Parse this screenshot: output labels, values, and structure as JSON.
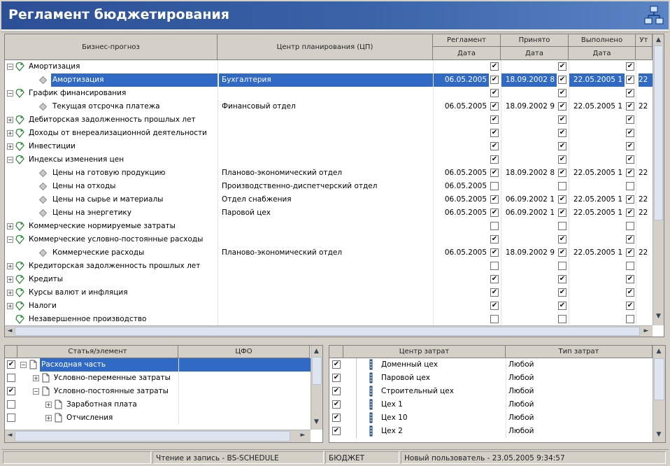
{
  "window": {
    "title": "Регламент бюджетирования"
  },
  "top_grid": {
    "headers": {
      "col1": "Бизнес-прогноз",
      "col2": "Центр планирования (ЦП)",
      "reglament": "Регламент",
      "prinyato": "Принято",
      "vypolneno": "Выполнено",
      "extra": "Ут",
      "date": "Дата"
    },
    "rows": [
      {
        "name": "Амортизация",
        "level": 0,
        "kind": "folder",
        "expand": "−",
        "center": "",
        "d1": "",
        "c1": "✔",
        "d2": "",
        "c2": "✔",
        "d3": "",
        "c3": "✔",
        "d4": ""
      },
      {
        "name": "Амортизация",
        "level": 1,
        "kind": "item",
        "expand": "",
        "center": "Бухгалтерия",
        "d1": "06.05.2005",
        "c1": "✔",
        "d2": "18.09.2002 8",
        "c2": "✔",
        "d3": "22.05.2005 1",
        "c3": "✔",
        "d4": "22",
        "selected": true
      },
      {
        "name": "График финансирования",
        "level": 0,
        "kind": "folder",
        "expand": "−",
        "center": "",
        "d1": "",
        "c1": "✔",
        "d2": "",
        "c2": "✔",
        "d3": "",
        "c3": "✔",
        "d4": ""
      },
      {
        "name": "Текущая отсрочка платежа",
        "level": 1,
        "kind": "item",
        "expand": "",
        "center": "Финансовый отдел",
        "d1": "06.05.2005",
        "c1": "✔",
        "d2": "18.09.2002 9",
        "c2": "✔",
        "d3": "22.05.2005 1",
        "c3": "✔",
        "d4": "22"
      },
      {
        "name": "Дебиторская задолженность прошлых лет",
        "level": 0,
        "kind": "folder",
        "expand": "+",
        "center": "",
        "d1": "",
        "c1": "✔",
        "d2": "",
        "c2": "✔",
        "d3": "",
        "c3": "✔",
        "d4": ""
      },
      {
        "name": "Доходы от внереализационной деятельности",
        "level": 0,
        "kind": "folder",
        "expand": "+",
        "center": "",
        "d1": "",
        "c1": "✔",
        "d2": "",
        "c2": "✔",
        "d3": "",
        "c3": "✔",
        "d4": ""
      },
      {
        "name": "Инвестиции",
        "level": 0,
        "kind": "folder",
        "expand": "+",
        "center": "",
        "d1": "",
        "c1": "✔",
        "d2": "",
        "c2": "✔",
        "d3": "",
        "c3": "✔",
        "d4": ""
      },
      {
        "name": "Индексы изменения цен",
        "level": 0,
        "kind": "folder",
        "expand": "−",
        "center": "",
        "d1": "",
        "c1": "✔",
        "d2": "",
        "c2": "✔",
        "d3": "",
        "c3": "✔",
        "d4": ""
      },
      {
        "name": "Цены на готовую продукцию",
        "level": 1,
        "kind": "item",
        "expand": "",
        "center": "Планово-экономический отдел",
        "d1": "06.05.2005",
        "c1": "✔",
        "d2": "18.09.2002 8",
        "c2": "✔",
        "d3": "22.05.2005 1",
        "c3": "✔",
        "d4": "22"
      },
      {
        "name": "Цены на отходы",
        "level": 1,
        "kind": "item",
        "expand": "",
        "center": "Производственно-диспетчерский отдел",
        "d1": "06.05.2005",
        "c1": "",
        "d2": "",
        "c2": "",
        "d3": "",
        "c3": "",
        "d4": ""
      },
      {
        "name": "Цены на сырье и материалы",
        "level": 1,
        "kind": "item",
        "expand": "",
        "center": "Отдел снабжения",
        "d1": "06.05.2005",
        "c1": "✔",
        "d2": "06.09.2002 1",
        "c2": "✔",
        "d3": "22.05.2005 1",
        "c3": "✔",
        "d4": "22"
      },
      {
        "name": "Цены на энергетику",
        "level": 1,
        "kind": "item",
        "expand": "",
        "center": "Паровой цех",
        "d1": "06.05.2005",
        "c1": "✔",
        "d2": "06.09.2002 1",
        "c2": "✔",
        "d3": "22.05.2005 1",
        "c3": "✔",
        "d4": "22"
      },
      {
        "name": "Коммерческие нормируемые затраты",
        "level": 0,
        "kind": "folder",
        "expand": "+",
        "center": "",
        "d1": "",
        "c1": "",
        "d2": "",
        "c2": "",
        "d3": "",
        "c3": "",
        "d4": ""
      },
      {
        "name": "Коммерческие условно-постоянные расходы",
        "level": 0,
        "kind": "folder",
        "expand": "−",
        "center": "",
        "d1": "",
        "c1": "✔",
        "d2": "",
        "c2": "✔",
        "d3": "",
        "c3": "✔",
        "d4": ""
      },
      {
        "name": "Коммерческие расходы",
        "level": 1,
        "kind": "item",
        "expand": "",
        "center": "Планово-экономический отдел",
        "d1": "06.05.2005",
        "c1": "✔",
        "d2": "18.09.2002 9",
        "c2": "✔",
        "d3": "22.05.2005 1",
        "c3": "✔",
        "d4": "22"
      },
      {
        "name": "Кредиторская задолженность прошлых лет",
        "level": 0,
        "kind": "folder",
        "expand": "+",
        "center": "",
        "d1": "",
        "c1": "",
        "d2": "",
        "c2": "",
        "d3": "",
        "c3": "",
        "d4": ""
      },
      {
        "name": "Кредиты",
        "level": 0,
        "kind": "folder",
        "expand": "+",
        "center": "",
        "d1": "",
        "c1": "✔",
        "d2": "",
        "c2": "✔",
        "d3": "",
        "c3": "✔",
        "d4": ""
      },
      {
        "name": "Курсы валют и инфляция",
        "level": 0,
        "kind": "folder",
        "expand": "+",
        "center": "",
        "d1": "",
        "c1": "✔",
        "d2": "",
        "c2": "✔",
        "d3": "",
        "c3": "✔",
        "d4": ""
      },
      {
        "name": "Налоги",
        "level": 0,
        "kind": "folder",
        "expand": "+",
        "center": "",
        "d1": "",
        "c1": "✔",
        "d2": "",
        "c2": "✔",
        "d3": "",
        "c3": "✔",
        "d4": ""
      },
      {
        "name": "Незавершенное производство",
        "level": 0,
        "kind": "folder",
        "expand": "",
        "center": "",
        "d1": "",
        "c1": "",
        "d2": "",
        "c2": "",
        "d3": "",
        "c3": "",
        "d4": ""
      }
    ]
  },
  "left_pane": {
    "headers": {
      "col1": "Статья/элемент",
      "col2": "ЦФО"
    },
    "rows": [
      {
        "checked": "✔",
        "expand": "−",
        "level": 0,
        "name": "Расходная часть",
        "selected": true
      },
      {
        "checked": "",
        "expand": "+",
        "level": 1,
        "name": "Условно-переменные затраты"
      },
      {
        "checked": "✔",
        "expand": "−",
        "level": 1,
        "name": "Условно-постоянные затраты"
      },
      {
        "checked": "",
        "expand": "+",
        "level": 2,
        "name": "Заработная плата"
      },
      {
        "checked": "",
        "expand": "+",
        "level": 2,
        "name": "Отчисления"
      }
    ]
  },
  "right_pane": {
    "headers": {
      "col1": "Центр затрат",
      "col2": "Тип затрат"
    },
    "rows": [
      {
        "checked": "✔",
        "name": "Доменный цех",
        "type": "Любой"
      },
      {
        "checked": "✔",
        "name": "Паровой цех",
        "type": "Любой"
      },
      {
        "checked": "✔",
        "name": "Строительный цех",
        "type": "Любой"
      },
      {
        "checked": "✔",
        "name": "Цех 1",
        "type": "Любой"
      },
      {
        "checked": "✔",
        "name": "Цех 10",
        "type": "Любой"
      },
      {
        "checked": "✔",
        "name": "Цех 2",
        "type": "Любой"
      }
    ]
  },
  "status": {
    "mode": "Чтение и запись - BS-SCHEDULE",
    "db": "БЮДЖЕТ",
    "user": "Новый пользователь - 23.05.2005 9:34:57"
  },
  "colors": {
    "title_bar": "#2c4f96",
    "selection": "#0a246a",
    "folder_icon": "#2e8b3a"
  }
}
